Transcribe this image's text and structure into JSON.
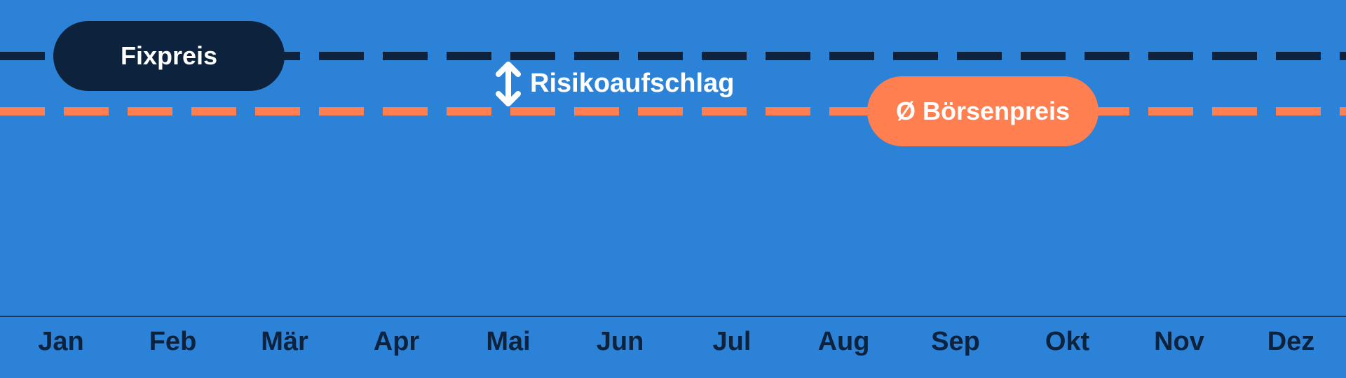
{
  "labels": {
    "fixpreis": "Fixpreis",
    "boersenpreis": "Ø Börsenpreis",
    "risikoaufschlag": "Risikoaufschlag"
  },
  "months": [
    "Jan",
    "Feb",
    "Mär",
    "Apr",
    "Mai",
    "Jun",
    "Jul",
    "Aug",
    "Sep",
    "Okt",
    "Nov",
    "Dez"
  ],
  "colors": {
    "background": "#2C82D6",
    "fixpreis_line": "#0D223D",
    "boersenpreis_line": "#FF7F50",
    "text_light": "#FFFFFF",
    "axis_text": "#0D223D"
  },
  "icons": {
    "spread_arrow": "double-vertical-arrow-icon"
  }
}
